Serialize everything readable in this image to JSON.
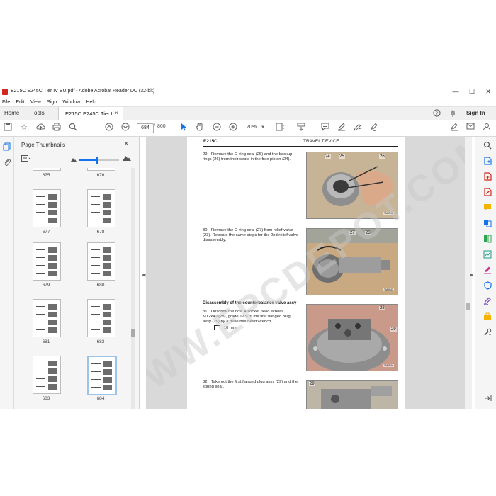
{
  "window": {
    "title": "E215C E245C Tier IV EU.pdf - Adobe Acrobat Reader DC (32-bit)",
    "controls": [
      "—",
      "☐",
      "✕"
    ]
  },
  "menu": [
    "File",
    "Edit",
    "View",
    "Sign",
    "Window",
    "Help"
  ],
  "tabs": {
    "home": "Home",
    "tools": "Tools",
    "document": "E215C E245C Tier I...",
    "close": "×",
    "sign_in": "Sign In"
  },
  "toolbar": {
    "current_page": "684",
    "separator": "/",
    "total_pages": "860",
    "zoom": "70%"
  },
  "panel": {
    "title": "Page Thumbnails",
    "close": "×",
    "thumbnail_size_fraction": 0.45,
    "thumbnails": [
      {
        "label": "675"
      },
      {
        "label": "676"
      },
      {
        "label": "677"
      },
      {
        "label": "678"
      },
      {
        "label": "679"
      },
      {
        "label": "680"
      },
      {
        "label": "681"
      },
      {
        "label": "682"
      },
      {
        "label": "683"
      },
      {
        "label": "684",
        "selected": true
      }
    ]
  },
  "document": {
    "header_left": "E215C",
    "header_right": "TRAVEL DEVICE",
    "steps": [
      {
        "num": "29.",
        "text": "Remove the O-ring seal (25) and the backup rings (26) from their seats in the free piston (24)."
      },
      {
        "num": "30.",
        "text": "Remove the O-ring seal (27) from relief valve (23). Repeate the same steps for the 2nd relief valve disassembly."
      },
      {
        "num": "31.",
        "text": "Unscrew the nos. 4 socket head screws M12x40 (28), grade 12.9 of the first flanged plug assy (29) by a male hex head wrench."
      },
      {
        "num": "32.",
        "text": "Take out the first flanged plug assy (29) and the spring seat."
      }
    ],
    "section_title": "Disassembly of the counterbalance valve assy",
    "wrench_note": ": 10 mm",
    "photos": [
      {
        "callouts": [
          "24",
          "25",
          "26"
        ],
        "code": "TM0542"
      },
      {
        "callouts": [
          "27",
          "23"
        ],
        "code": "TM0543"
      },
      {
        "callouts": [
          "28",
          "29"
        ],
        "code": "TM0544"
      },
      {
        "callouts": [
          "29"
        ]
      }
    ],
    "watermark": "WWW.EPCDEPOT.COM"
  },
  "colors": {
    "accent": "#1473e6",
    "pdf_red": "#d1281f",
    "doc_background": "#d9d9d9"
  }
}
